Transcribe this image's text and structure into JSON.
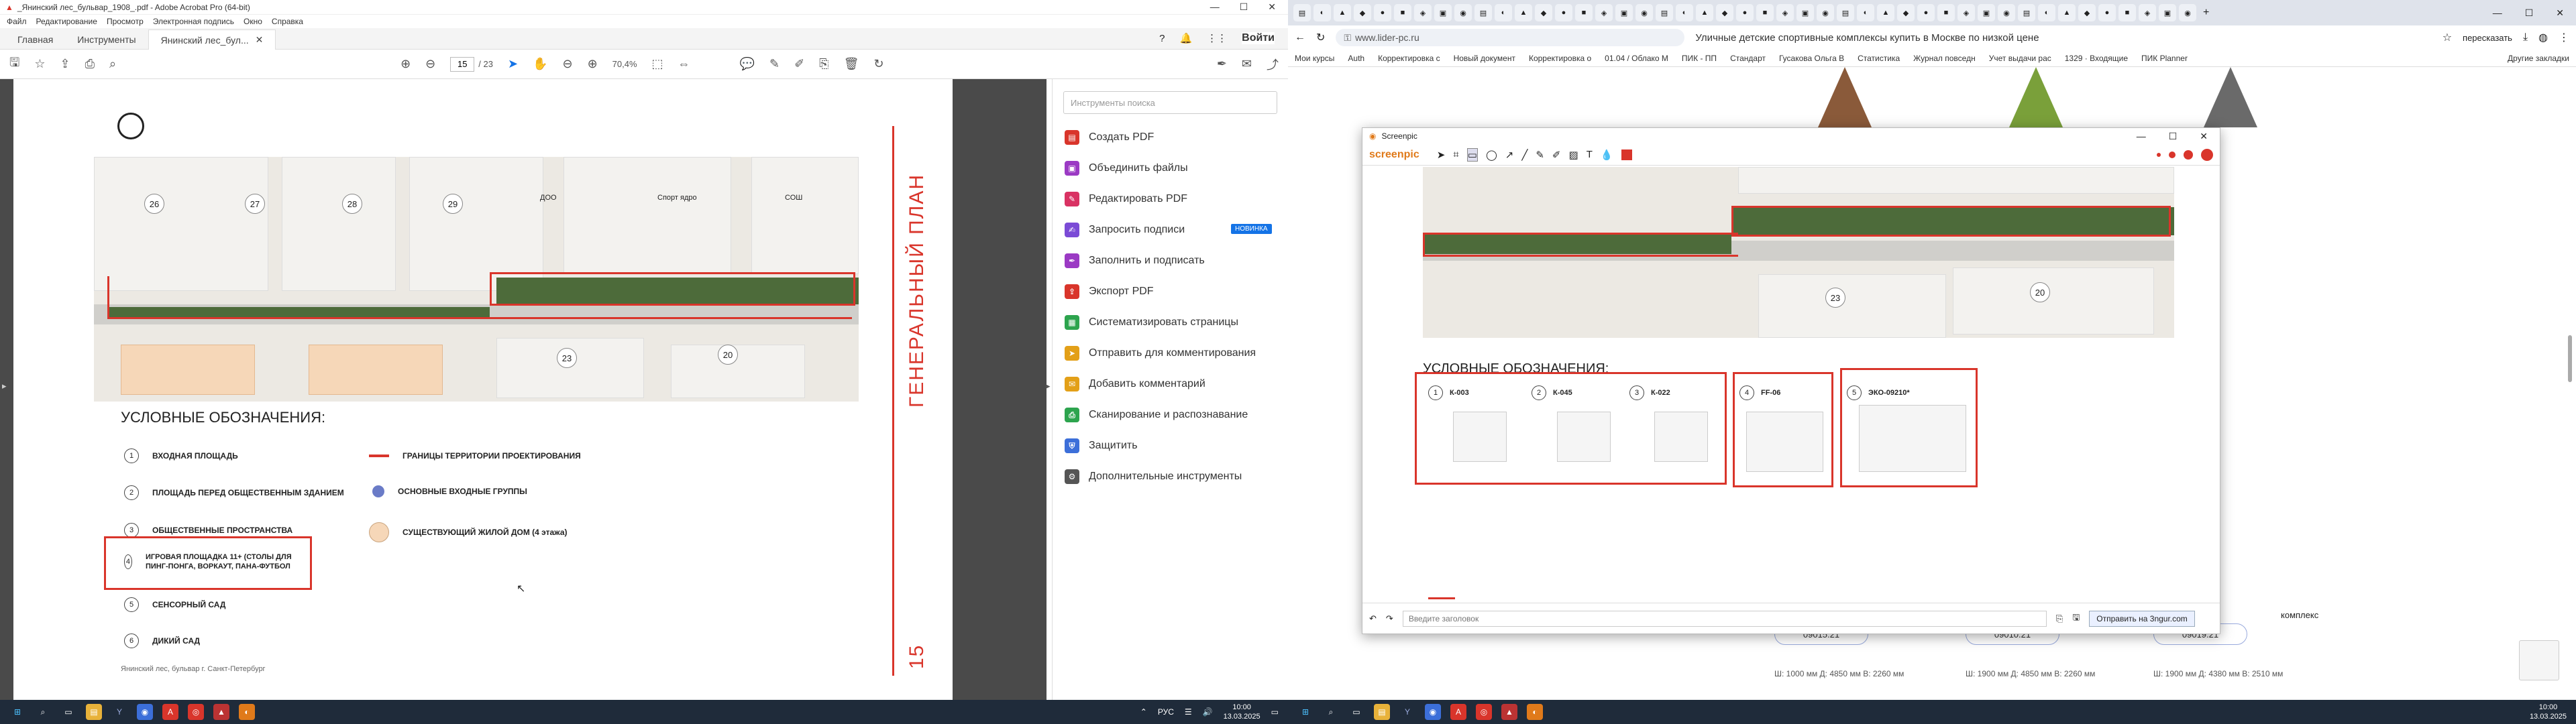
{
  "acrobat": {
    "title": "_Янинский лес_бульвар_1908_.pdf - Adobe Acrobat Pro (64-bit)",
    "menu": [
      "Файл",
      "Редактирование",
      "Просмотр",
      "Электронная подпись",
      "Окно",
      "Справка"
    ],
    "tabs": {
      "home": "Главная",
      "tools": "Инструменты",
      "doc": "Янинский лес_бул..."
    },
    "login": "Войти",
    "page_current": "15",
    "page_total": "/ 23",
    "zoom": "70,4%",
    "right_pane": {
      "search_placeholder": "Инструменты поиска",
      "items": [
        {
          "label": "Создать PDF",
          "color": "#d9352b"
        },
        {
          "label": "Объединить файлы",
          "color": "#9b3ac4"
        },
        {
          "label": "Редактировать PDF",
          "color": "#d93263"
        },
        {
          "label": "Запросить подписи",
          "color": "#7b4bd6",
          "badge": "НОВИНКА"
        },
        {
          "label": "Заполнить и подписать",
          "color": "#9b3ac4"
        },
        {
          "label": "Экспорт PDF",
          "color": "#d9352b"
        },
        {
          "label": "Систематизировать страницы",
          "color": "#2da44e"
        },
        {
          "label": "Отправить для комментирования",
          "color": "#e3a018"
        },
        {
          "label": "Добавить комментарий",
          "color": "#e3a018"
        },
        {
          "label": "Сканирование и распознавание",
          "color": "#2da44e"
        },
        {
          "label": "Защитить",
          "color": "#3c6fd9"
        },
        {
          "label": "Дополнительные инструменты",
          "color": "#555555"
        }
      ]
    },
    "map": {
      "numbers": [
        "26",
        "27",
        "28",
        "29",
        "23",
        "20"
      ],
      "labels": {
        "doo": "ДОО",
        "sport": "Спорт ядро",
        "sosh": "СОШ"
      },
      "side_title": "ГЕНЕРАЛЬНЫЙ ПЛАН",
      "page_number": "15",
      "footer": "Янинский лес, бульвар г. Санкт-Петербург"
    },
    "legend": {
      "title": "УСЛОВНЫЕ ОБОЗНАЧЕНИЯ:",
      "items": [
        {
          "n": "1",
          "text": "ВХОДНАЯ ПЛОЩАДЬ"
        },
        {
          "n": "2",
          "text": "ПЛОЩАДЬ ПЕРЕД ОБЩЕСТВЕННЫМ ЗДАНИЕМ"
        },
        {
          "n": "3",
          "text": "ОБЩЕСТВЕННЫЕ ПРОСТРАНСТВА"
        },
        {
          "n": "4",
          "text": "ИГРОВАЯ ПЛОЩАДКА 11+ (СТОЛЫ ДЛЯ ПИНГ-ПОНГА, ВОРКАУТ, ПАНА-ФУТБОЛ"
        },
        {
          "n": "5",
          "text": "СЕНСОРНЫЙ САД"
        },
        {
          "n": "6",
          "text": "ДИКИЙ САД"
        }
      ],
      "right": [
        {
          "text": "ГРАНИЦЫ ТЕРРИТОРИИ ПРОЕКТИРОВАНИЯ"
        },
        {
          "text": "ОСНОВНЫЕ ВХОДНЫЕ ГРУППЫ"
        },
        {
          "text": "СУЩЕСТВУЮЩИЙ ЖИЛОЙ ДОМ (4 этажа)"
        }
      ]
    }
  },
  "browser": {
    "url": "www.lider-pc.ru",
    "page_title": "Уличные детские спортивные комплексы купить в Москве по низкой цене",
    "bookmarks": [
      "Мои курсы",
      "Auth",
      "Корректировка с",
      "Новый документ",
      "Корректировка о",
      "01.04 / Облако М",
      "ПИК - ПП",
      "Стандарт",
      "Гусакова Ольга В",
      "Статистика",
      "Журнал повседн",
      "Учет выдачи рас",
      "1329 · Входящие",
      "ПИК Planner"
    ],
    "other_bookmarks": "Другие закладки",
    "translate": "пересказать",
    "products": [
      {
        "code": "09015.21",
        "dims": "Ш: 1000 мм Д: 4850 мм В: 2260 мм"
      },
      {
        "code": "09010.21",
        "dims": "Ш: 1900 мм Д: 4850 мм В: 2260 мм"
      },
      {
        "code": "09019.21",
        "dims": "Ш: 1900 мм Д: 4380 мм В: 2510 мм"
      }
    ],
    "complex_label": "комплекс"
  },
  "screenpic": {
    "title": "Screenpic",
    "logo": "screenpic",
    "legend_title": "УСЛОВНЫЕ ОБОЗНАЧЕНИЯ:",
    "map_numbers": [
      "23",
      "20"
    ],
    "equipment": [
      {
        "n": "1",
        "code": "К-003"
      },
      {
        "n": "2",
        "code": "К-045"
      },
      {
        "n": "3",
        "code": "К-022"
      },
      {
        "n": "4",
        "code": "FF-06"
      },
      {
        "n": "5",
        "code": "ЭКО-09210*"
      }
    ],
    "comment_placeholder": "Введите заголовок",
    "send_label": "Отправить на 3ngur.com"
  },
  "taskbar": {
    "lang": "РУС",
    "time": "10:00",
    "date": "13.03.2025"
  }
}
